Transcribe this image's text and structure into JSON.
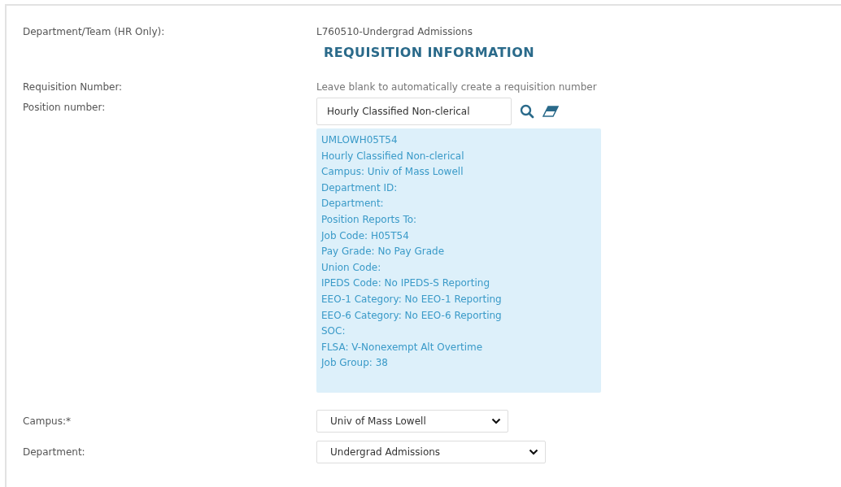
{
  "department_team": {
    "label": "Department/Team (HR Only):",
    "value": "L760510-Undergrad Admissions"
  },
  "section_heading": "REQUISITION INFORMATION",
  "requisition_number": {
    "label": "Requisition Number:",
    "hint": "Leave blank to automatically create a requisition number"
  },
  "position_number": {
    "label": "Position number:",
    "value": "Hourly Classified Non-clerical",
    "details": [
      "UMLOWH05T54",
      "Hourly Classified Non-clerical",
      "Campus: Univ of Mass Lowell",
      "Department ID:",
      "Department:",
      "Position Reports To:",
      "Job Code: H05T54",
      "Pay Grade: No Pay Grade",
      "Union Code:",
      "IPEDS Code: No IPEDS-S Reporting",
      "EEO-1 Category: No EEO-1 Reporting",
      "EEO-6 Category: No EEO-6 Reporting",
      "SOC:",
      "FLSA: V-Nonexempt Alt Overtime",
      "Job Group: 38"
    ]
  },
  "campus": {
    "label": "Campus:*",
    "value": "Univ of Mass Lowell"
  },
  "department": {
    "label": "Department:",
    "value": "Undergrad Admissions"
  }
}
